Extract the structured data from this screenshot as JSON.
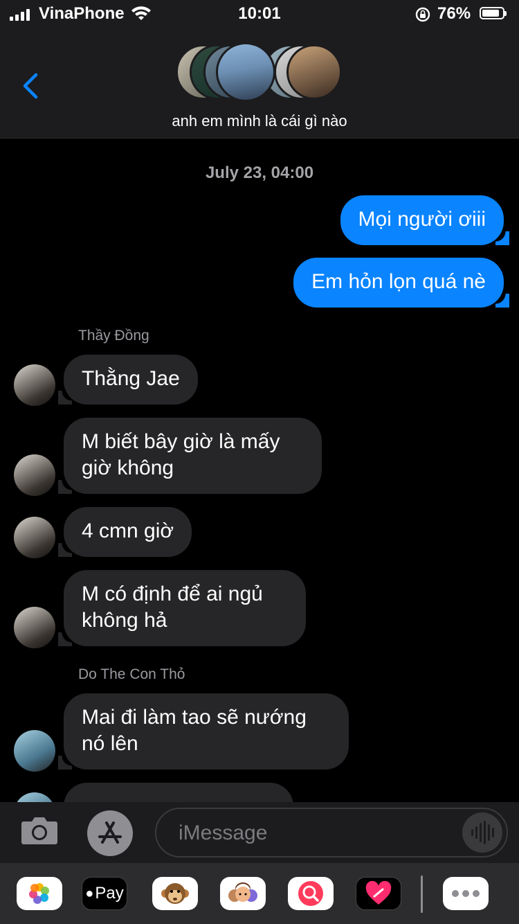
{
  "status_bar": {
    "carrier": "VinaPhone",
    "time": "10:01",
    "battery_percent": "76%",
    "battery_level": 0.76
  },
  "header": {
    "group_name": "anh em mình là cái gì nào"
  },
  "thread": {
    "date_label": "July 23, 04:00",
    "outgoing": [
      "Mọi người ơiii",
      "Em hỏn lọn quá nè"
    ],
    "sender_1": "Thầy Đồng",
    "sender_1_messages": [
      "Thằng Jae",
      "M biết bây giờ là mấy giờ không",
      "4 cmn giờ",
      "M có định để ai ngủ không hả"
    ],
    "sender_2": "Do The Con Thỏ",
    "sender_2_messages": [
      "Mai đi làm tao sẽ nướng nó lên"
    ]
  },
  "input": {
    "placeholder": "iMessage"
  },
  "app_drawer": {
    "apple_pay_label": "Pay"
  },
  "colors": {
    "outgoing_bubble": "#0a84ff",
    "incoming_bubble": "#262628",
    "background": "#000000"
  }
}
